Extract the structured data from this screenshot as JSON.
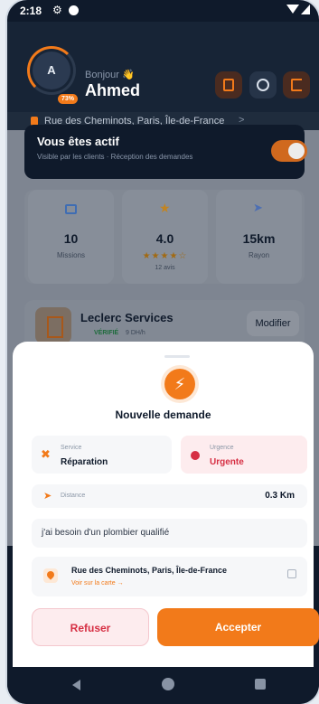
{
  "status_bar": {
    "time": "2:18"
  },
  "header": {
    "avatar_initial": "A",
    "avatar_progress": "73%",
    "greeting": "Bonjour 👋",
    "username": "Ahmed",
    "location": "Rue des Cheminots, Paris, Île-de-France",
    "location_chevron": ">"
  },
  "active_card": {
    "title": "Vous êtes actif",
    "subtitle": "Visible par les clients · Réception des demandes",
    "toggle_on": true
  },
  "stats": [
    {
      "icon": "briefcase-icon",
      "value": "10",
      "label": "Missions"
    },
    {
      "icon": "star-icon",
      "value": "4.0",
      "stars": "★★★★☆",
      "reviews": "12 avis"
    },
    {
      "icon": "navigation-icon",
      "value": "15km",
      "label": "Rayon"
    }
  ],
  "company": {
    "name": "Leclerc Services",
    "verified": "VÉRIFIÉ",
    "rate": "9 DH/h",
    "modify_label": "Modifier"
  },
  "request_modal": {
    "title": "Nouvelle demande",
    "service_label": "Service",
    "service_value": "Réparation",
    "urgency_label": "Urgence",
    "urgency_value": "Urgente",
    "distance_label": "Distance",
    "distance_value": "0.3 Km",
    "description": "j'ai besoin d'un plombier qualifié",
    "address": "Rue des Cheminots, Paris, Île-de-France",
    "map_link": "Voir sur la carte →",
    "refuse_label": "Refuser",
    "accept_label": "Accepter"
  },
  "colors": {
    "accent": "#f27a1a",
    "danger": "#d62f43",
    "dark": "#0f1a2b"
  }
}
